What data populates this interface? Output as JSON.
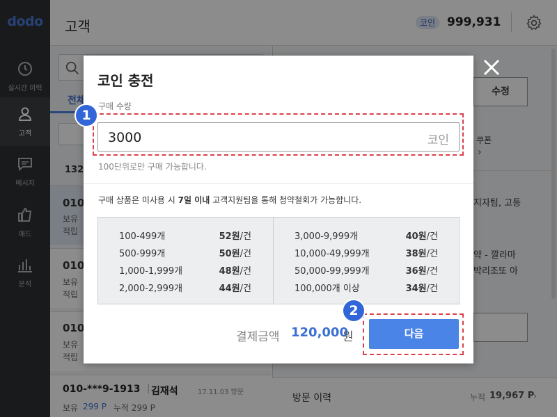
{
  "app": {
    "logo": "dodo",
    "title": "고객",
    "coin_badge": "코인",
    "coin_balance": "999,931"
  },
  "sidebar": [
    {
      "label": "실시간 이력",
      "icon": "clock-icon"
    },
    {
      "label": "고객",
      "icon": "user-icon"
    },
    {
      "label": "메시지",
      "icon": "message-icon"
    },
    {
      "label": "애드",
      "icon": "thumbs-up-icon"
    },
    {
      "label": "분석",
      "icon": "chart-icon"
    }
  ],
  "background": {
    "tab": "전체",
    "edit_button": "수정",
    "coupon": "쿠폰",
    "text1": "지자팀, 고등",
    "text2": "약 - 깔라마",
    "text3": "박리조또 아",
    "list_top": "132",
    "card1_num": "010",
    "card1_a": "보유",
    "card1_b": "적립",
    "card2_num": "010",
    "card2_a": "보유",
    "card2_b": "적립",
    "card3_num": "010",
    "card3_a": "보유",
    "card3_b": "적립",
    "card4_num": "010-***9-1913",
    "card4_name": "김재석",
    "card4_date": "17.11.03 방문",
    "card4_hold": "보유",
    "card4_hold_val": "299 P",
    "card4_acc": "누적 299 P",
    "visit_label": "방문 이력",
    "visit_total_label": "누적",
    "visit_total": "19,967 P"
  },
  "modal": {
    "title": "코인 충전",
    "qty_label": "구매 수량",
    "qty_value": "3000",
    "qty_unit": "코인",
    "qty_hint": "100단위로만 구매 가능합니다.",
    "notice_pre": "구매 상품은 미사용 시 ",
    "notice_bold": "7일 이내",
    "notice_post": " 고객지원팀을 통해 청약철회가 가능합니다.",
    "prices_left": [
      {
        "range": "100-499개",
        "price": "52원",
        "unit": "/건"
      },
      {
        "range": "500-999개",
        "price": "50원",
        "unit": "/건"
      },
      {
        "range": "1,000-1,999개",
        "price": "48원",
        "unit": "/건"
      },
      {
        "range": "2,000-2,999개",
        "price": "44원",
        "unit": "/건"
      }
    ],
    "prices_right": [
      {
        "range": "3,000-9,999개",
        "price": "40원",
        "unit": "/건"
      },
      {
        "range": "10,000-49,999개",
        "price": "38원",
        "unit": "/건"
      },
      {
        "range": "50,000-99,999개",
        "price": "36원",
        "unit": "/건"
      },
      {
        "range": "100,000개 이상",
        "price": "34원",
        "unit": "/건"
      }
    ],
    "pay_label": "결제금액",
    "pay_amount": "120,000",
    "pay_unit": "원",
    "next_button": "다음"
  },
  "annotations": {
    "badge1": "1",
    "badge2": "2"
  }
}
